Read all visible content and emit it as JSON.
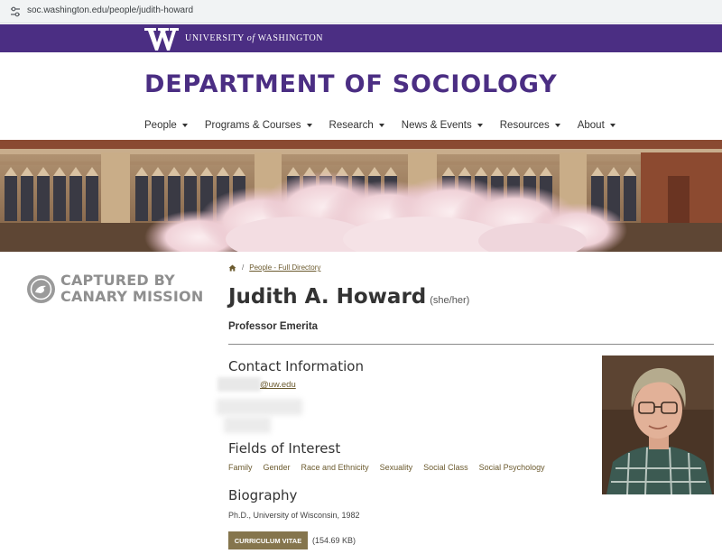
{
  "browser": {
    "url": "soc.washington.edu/people/judith-howard"
  },
  "uw_header": {
    "name_before": "UNIVERSITY ",
    "name_italic": "of",
    "name_after": " WASHINGTON"
  },
  "department": {
    "title": "DEPARTMENT OF SOCIOLOGY"
  },
  "nav": {
    "items": [
      {
        "label": "People"
      },
      {
        "label": "Programs & Courses"
      },
      {
        "label": "Research"
      },
      {
        "label": "News & Events"
      },
      {
        "label": "Resources"
      },
      {
        "label": "About"
      }
    ]
  },
  "watermark": {
    "line1": "CAPTURED BY",
    "line2": "CANARY MISSION"
  },
  "breadcrumb": {
    "separator": "/",
    "link": "People - Full Directory"
  },
  "profile": {
    "name": "Judith A. Howard",
    "pronouns": "(she/her)",
    "title": "Professor Emerita",
    "contact_heading": "Contact Information",
    "email_suffix": "@uw.edu",
    "fields_heading": "Fields of Interest",
    "fields": [
      "Family",
      "Gender",
      "Race and Ethnicity",
      "Sexuality",
      "Social Class",
      "Social Psychology"
    ],
    "bio_heading": "Biography",
    "bio_text": "Ph.D., University of Wisconsin, 1982",
    "cv_label": "CURRICULUM VITAE",
    "cv_size": "(154.69 KB)"
  },
  "colors": {
    "uw_purple": "#4b2e83",
    "gold_link": "#6b5a2e",
    "cv_button": "#85754d"
  }
}
